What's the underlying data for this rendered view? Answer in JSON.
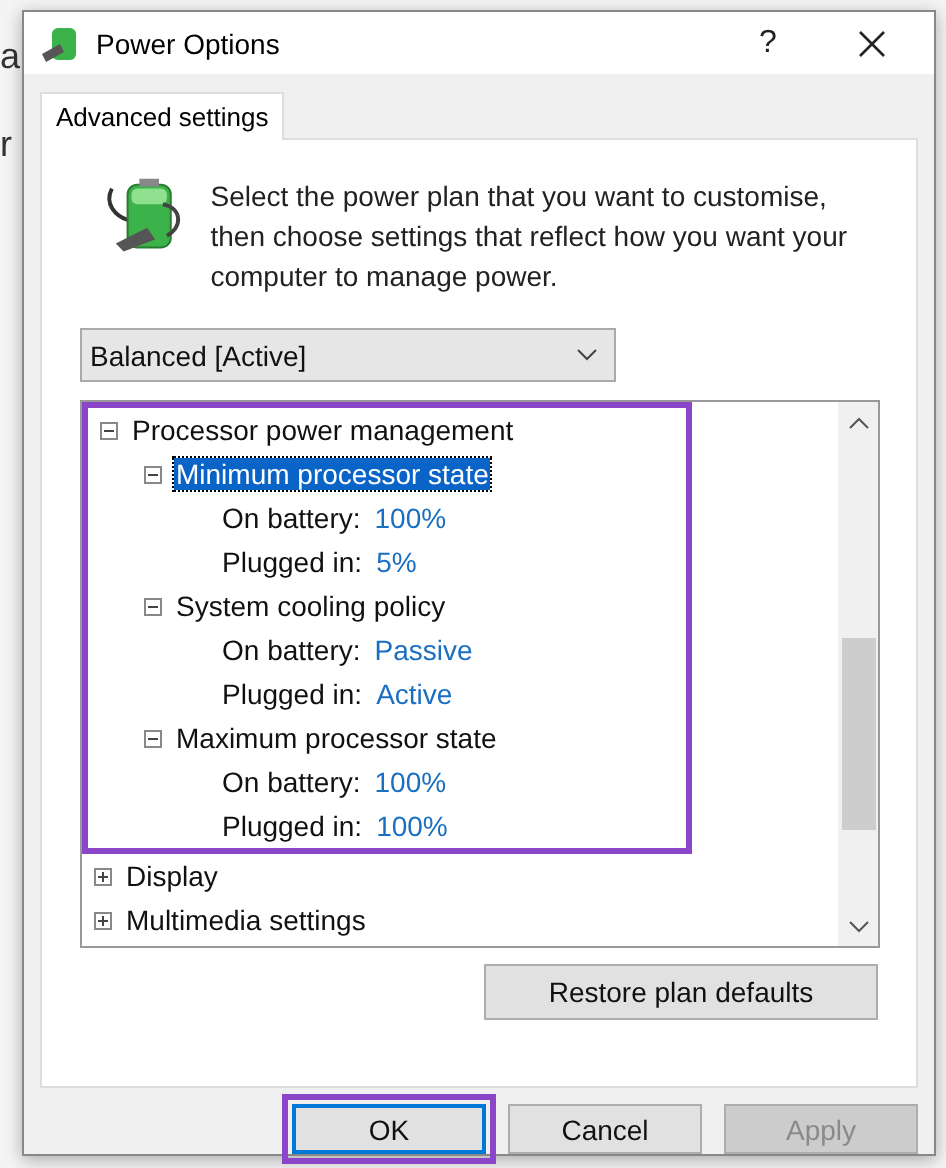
{
  "background_text": [
    "a",
    "r"
  ],
  "window": {
    "title": "Power Options",
    "help": "?"
  },
  "tabs": [
    {
      "label": "Advanced settings",
      "selected": true
    }
  ],
  "intro": "Select the power plan that you want to customise, then choose settings that reflect how you want your computer to manage power.",
  "plan_dropdown": {
    "value": "Balanced [Active]"
  },
  "tree": [
    {
      "label": "Processor power management",
      "expanded": true,
      "selected": false,
      "highlighted": true,
      "children": [
        {
          "label": "Minimum processor state",
          "expanded": true,
          "selected": true,
          "children": [
            {
              "label": "On battery:",
              "value": "100%"
            },
            {
              "label": "Plugged in:",
              "value": "5%"
            }
          ]
        },
        {
          "label": "System cooling policy",
          "expanded": true,
          "selected": false,
          "children": [
            {
              "label": "On battery:",
              "value": "Passive"
            },
            {
              "label": "Plugged in:",
              "value": "Active"
            }
          ]
        },
        {
          "label": "Maximum processor state",
          "expanded": true,
          "selected": false,
          "children": [
            {
              "label": "On battery:",
              "value": "100%"
            },
            {
              "label": "Plugged in:",
              "value": "100%"
            }
          ]
        }
      ]
    },
    {
      "label": "Display",
      "expanded": false,
      "selected": false
    },
    {
      "label": "Multimedia settings",
      "expanded": false,
      "selected": false
    }
  ],
  "restore_button": "Restore plan defaults",
  "buttons": [
    {
      "label": "OK",
      "default": true,
      "disabled": false,
      "highlighted": true
    },
    {
      "label": "Cancel",
      "default": false,
      "disabled": false,
      "highlighted": false
    },
    {
      "label": "Apply",
      "default": false,
      "disabled": true,
      "highlighted": false
    }
  ]
}
